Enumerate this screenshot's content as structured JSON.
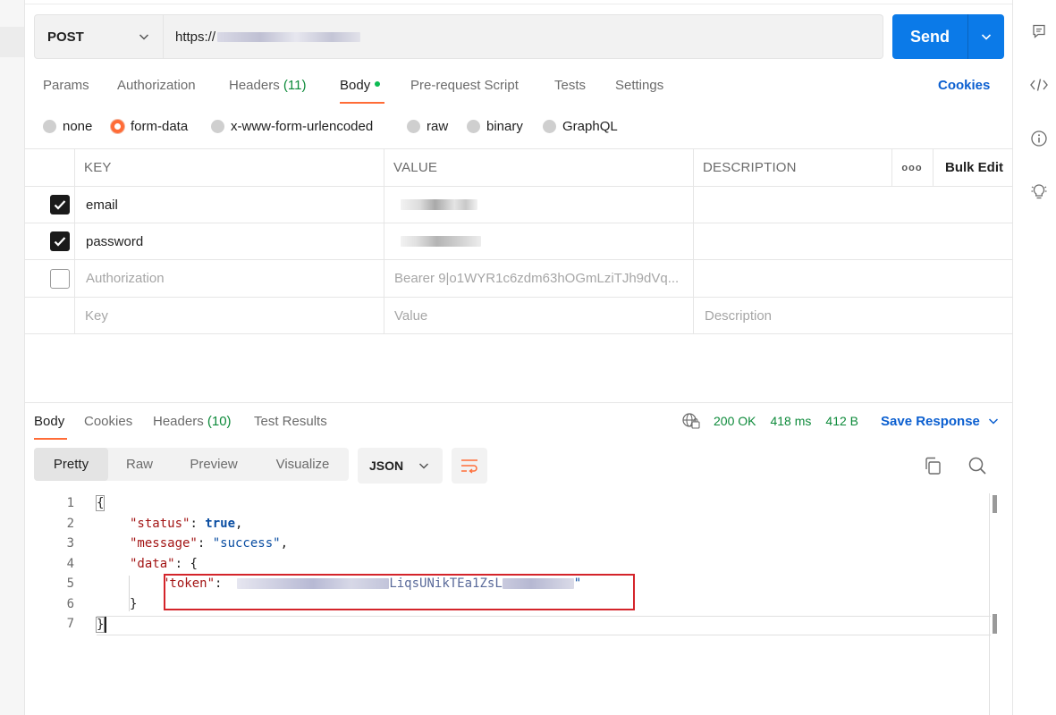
{
  "request": {
    "method": "POST",
    "url": "https://",
    "send_label": "Send"
  },
  "request_tabs": [
    {
      "label": "Params"
    },
    {
      "label": "Authorization"
    },
    {
      "label": "Headers",
      "count": "(11)"
    },
    {
      "label": "Body",
      "active": true
    },
    {
      "label": "Pre-request Script"
    },
    {
      "label": "Tests"
    },
    {
      "label": "Settings"
    }
  ],
  "cookies_label": "Cookies",
  "body_types": [
    "none",
    "form-data",
    "x-www-form-urlencoded",
    "raw",
    "binary",
    "GraphQL"
  ],
  "body_type_selected": "form-data",
  "params_table": {
    "headers": {
      "key": "KEY",
      "value": "VALUE",
      "description": "DESCRIPTION",
      "more": "ooo",
      "bulk_edit": "Bulk Edit"
    },
    "rows": [
      {
        "checked": true,
        "key": "email",
        "value": "",
        "description": ""
      },
      {
        "checked": true,
        "key": "password",
        "value": "",
        "description": ""
      },
      {
        "checked": false,
        "key": "Authorization",
        "value": "Bearer 9|o1WYR1c6zdm63hOGmLziTJh9dVq...",
        "description": ""
      }
    ],
    "placeholder": {
      "key": "Key",
      "value": "Value",
      "description": "Description"
    }
  },
  "response": {
    "tabs": [
      {
        "label": "Body",
        "active": true
      },
      {
        "label": "Cookies"
      },
      {
        "label": "Headers",
        "count": "(10)"
      },
      {
        "label": "Test Results"
      }
    ],
    "status": "200 OK",
    "time": "418 ms",
    "size": "412 B",
    "save_label": "Save Response",
    "views": [
      "Pretty",
      "Raw",
      "Preview",
      "Visualize"
    ],
    "view_selected": "Pretty",
    "format": "JSON"
  },
  "code": {
    "line_numbers": [
      "1",
      "2",
      "3",
      "4",
      "5",
      "6",
      "7"
    ],
    "l1": "{",
    "l2_key": "\"status\"",
    "l2_val": "true",
    "l3_key": "\"message\"",
    "l3_val": "\"success\"",
    "l4_key": "\"data\"",
    "l4_open": "{",
    "l5_key": "\"token\"",
    "l5_fragment": "LiqsUNikTEa1ZsL",
    "l5_end": "\"",
    "l6": "}",
    "l7": "}"
  },
  "colors": {
    "accent": "#ff6c37",
    "send": "#0b7ae8",
    "success": "#0d8a3a",
    "link": "#0b5fd0",
    "highlight_box": "#d4242a"
  }
}
